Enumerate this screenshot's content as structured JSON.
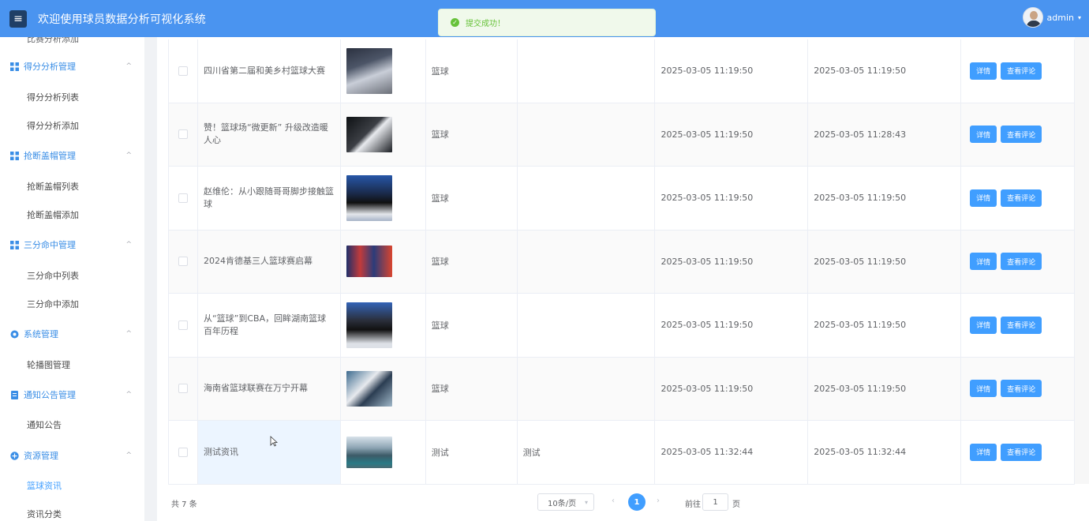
{
  "header": {
    "title": "欢迎使用球员数据分析可视化系统",
    "menu_icon": "hamburger-icon",
    "user_name": "admin"
  },
  "toast": {
    "message": "提交成功！",
    "icon": "success-check-icon"
  },
  "sidebar": {
    "cut_text": "比赛分析添加",
    "groups": [
      {
        "label": "得分分析管理",
        "items": [
          "得分分析列表",
          "得分分析添加"
        ]
      },
      {
        "label": "抢断盖帽管理",
        "items": [
          "抢断盖帽列表",
          "抢断盖帽添加"
        ]
      },
      {
        "label": "三分命中管理",
        "items": [
          "三分命中列表",
          "三分命中添加"
        ]
      },
      {
        "label": "系统管理",
        "items": [
          "轮播图管理"
        ]
      },
      {
        "label": "通知公告管理",
        "items": [
          "通知公告"
        ]
      },
      {
        "label": "资源管理",
        "items": [
          "篮球资讯",
          "资讯分类"
        ]
      }
    ],
    "active_item": "篮球资讯"
  },
  "table": {
    "buttons": {
      "detail": "详情",
      "comments": "查看评论"
    },
    "rows": [
      {
        "title": "四川省第二届和美乡村篮球大赛",
        "type": "篮球",
        "content": "",
        "time1": "2025-03-05 11:19:50",
        "time2": "2025-03-05 11:19:50"
      },
      {
        "title": "赞！篮球场“微更新” 升级改造暖人心",
        "type": "篮球",
        "content": "",
        "time1": "2025-03-05 11:19:50",
        "time2": "2025-03-05 11:28:43"
      },
      {
        "title": "赵维伦：从小跟随哥哥脚步接触篮球",
        "type": "篮球",
        "content": "",
        "time1": "2025-03-05 11:19:50",
        "time2": "2025-03-05 11:19:50"
      },
      {
        "title": "2024肯德基三人篮球赛启幕",
        "type": "篮球",
        "content": "",
        "time1": "2025-03-05 11:19:50",
        "time2": "2025-03-05 11:19:50"
      },
      {
        "title": "从“篮球”到CBA，回眸湖南篮球百年历程",
        "type": "篮球",
        "content": "",
        "time1": "2025-03-05 11:19:50",
        "time2": "2025-03-05 11:19:50"
      },
      {
        "title": "海南省篮球联赛在万宁开幕",
        "type": "篮球",
        "content": "",
        "time1": "2025-03-05 11:19:50",
        "time2": "2025-03-05 11:19:50"
      },
      {
        "title": "测试资讯",
        "type": "测试",
        "content": "测试",
        "time1": "2025-03-05 11:32:44",
        "time2": "2025-03-05 11:32:44"
      }
    ]
  },
  "pagination": {
    "total": "共 7 条",
    "page_size": "10条/页",
    "current_page": "1",
    "goto_label": "前往",
    "goto_value": "1",
    "goto_suffix": "页"
  }
}
